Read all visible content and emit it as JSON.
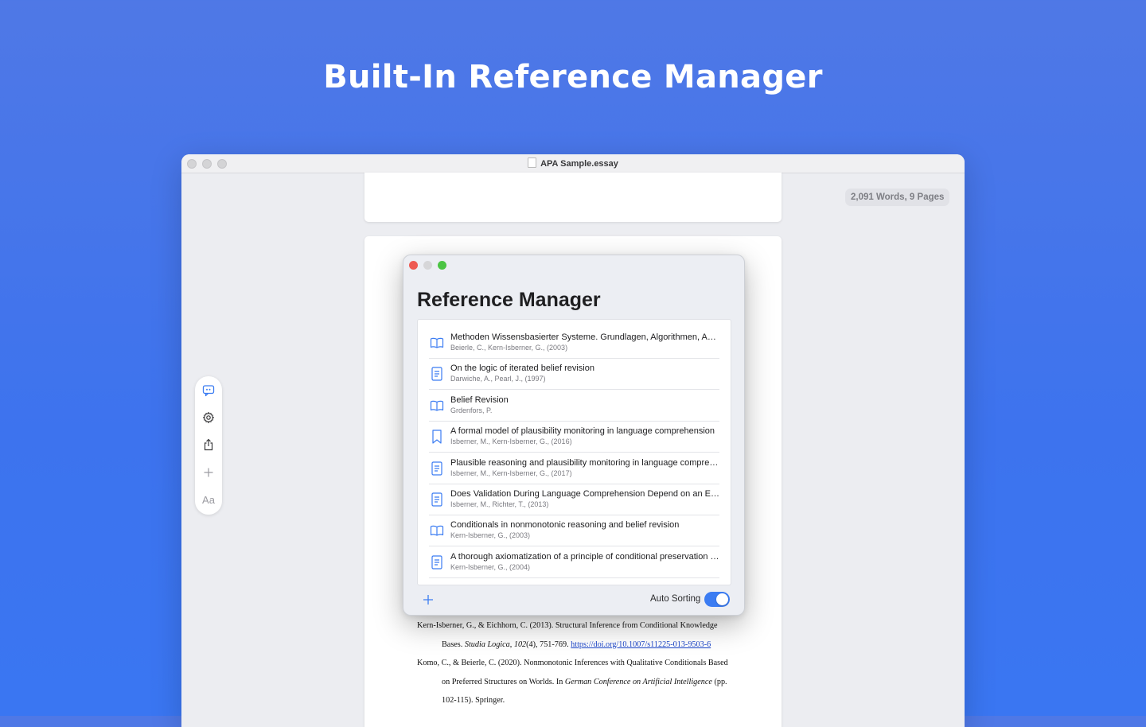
{
  "headline": "Built-In Reference Manager",
  "window": {
    "document_title": "APA Sample.essay",
    "word_count": "2,091 Words, 9 Pages"
  },
  "toolbar": {
    "icons": [
      "citation-icon",
      "gear-icon",
      "share-icon",
      "plus-icon",
      "font-icon"
    ],
    "font_label": "Aa"
  },
  "reference_manager": {
    "title": "Reference Manager",
    "auto_sorting_label": "Auto Sorting",
    "auto_sorting_on": true,
    "colors": {
      "close": "#ee5a52",
      "minimize": "#d6d6d8",
      "zoom": "#4bc443",
      "accent": "#3b7cf2"
    },
    "items": [
      {
        "icon": "book-icon",
        "title": "Methoden Wissensbasierter Systeme. Grundlagen, Algorithmen, Anwendungen",
        "authors": "Beierle, C., Kern-Isberner, G., (2003)"
      },
      {
        "icon": "document-icon",
        "title": "On the logic of iterated belief revision",
        "authors": "Darwiche, A., Pearl, J., (1997)"
      },
      {
        "icon": "book-icon",
        "title": "Belief Revision",
        "authors": "Grdenfors, P."
      },
      {
        "icon": "bookmark-icon",
        "title": "A formal model of plausibility monitoring in language comprehension",
        "authors": "Isberner, M., Kern-Isberner, G., (2016)"
      },
      {
        "icon": "document-icon",
        "title": "Plausible reasoning and plausibility monitoring in language comprehension",
        "authors": "Isberner, M., Kern-Isberner, G., (2017)"
      },
      {
        "icon": "document-icon",
        "title": "Does Validation During Language Comprehension Depend on an Evaluative Mindset?",
        "authors": "Isberner, M., Richter, T., (2013)"
      },
      {
        "icon": "book-icon",
        "title": "Conditionals in nonmonotonic reasoning and belief revision",
        "authors": "Kern-Isberner, G., (2003)"
      },
      {
        "icon": "document-icon",
        "title": "A thorough axiomatization of a principle of conditional preservation in belief revision",
        "authors": "Kern-Isberner, G., (2004)"
      }
    ]
  },
  "references_text": {
    "r1_line1": "Kern-Isberner, G., & Eichhorn, C. (2013). Structural Inference from Conditional Knowledge",
    "r1_line2_a": "Bases. ",
    "r1_line2_journal": "Studia Logica",
    "r1_line2_b": ", ",
    "r1_line2_vol": "102",
    "r1_line2_c": "(4), 751-769. ",
    "r1_link": "https://doi.org/10.1007/s11225-013-9503-6",
    "r2_line1": "Komo, C., & Beierle, C. (2020). Nonmonotonic Inferences with Qualitative Conditionals Based",
    "r2_line2_a": "on Preferred Structures on Worlds. In ",
    "r2_line2_conf": "German Conference on Artificial Intelligence",
    "r2_line2_b": " (pp.",
    "r2_line3": "102-115). Springer."
  }
}
